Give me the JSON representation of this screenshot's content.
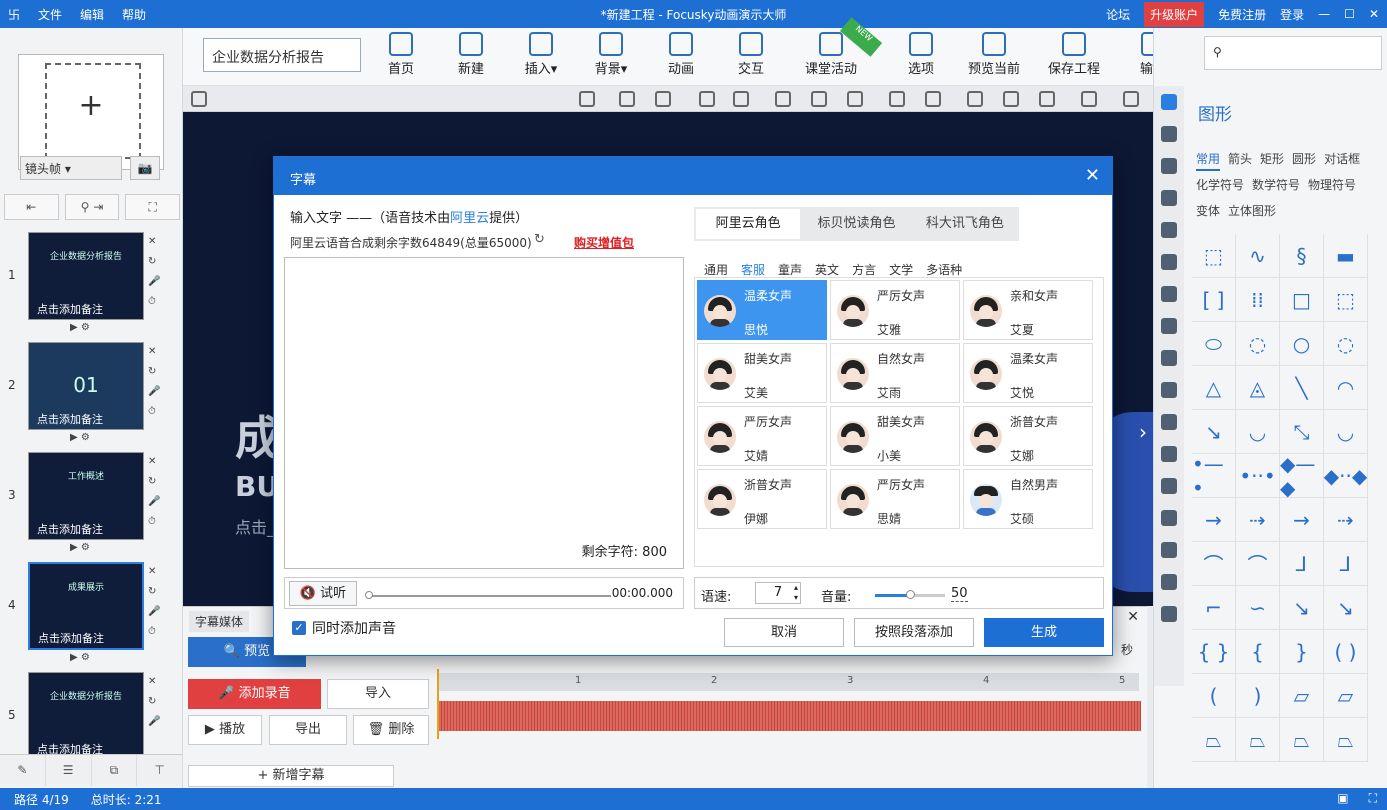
{
  "titlebar": {
    "menu": [
      "文件",
      "编辑",
      "帮助"
    ],
    "title": "*新建工程 - Focusky动画演示大师",
    "forum": "论坛",
    "upgrade": "升级账户",
    "register": "免费注册",
    "login": "登录"
  },
  "left": {
    "camera_select": "镜头帧",
    "slides": [
      {
        "num": "1",
        "caption": "企业数据分析报告",
        "note": "点击添加备注"
      },
      {
        "num": "2",
        "caption": "01",
        "note": "点击添加备注"
      },
      {
        "num": "3",
        "caption": "工作概述",
        "note": "点击添加备注"
      },
      {
        "num": "4",
        "caption": "成果展示",
        "note": "点击添加备注"
      },
      {
        "num": "5",
        "caption": "企业数据分析报告",
        "note": "点击添加备注"
      }
    ]
  },
  "status": {
    "path": "路径 4/19",
    "duration": "总时长: 2:21"
  },
  "toolbar": {
    "project_name": "企业数据分析报告",
    "buttons": [
      "首页",
      "新建",
      "插入",
      "背景",
      "动画",
      "交互",
      "课堂活动",
      "选项",
      "预览当前",
      "保存工程",
      "输出"
    ],
    "new_badge": "NEW"
  },
  "canvas": {
    "big": "成",
    "bu": "BU",
    "sub": "点击_"
  },
  "bottom": {
    "title": "字幕媒体",
    "preview": "预览",
    "add_record": "添加录音",
    "import": "导入",
    "play": "播放",
    "export": "导出",
    "delete": "删除",
    "add_subtitle": "+ 新增字幕",
    "sec": "秒",
    "ruler": [
      "1",
      "2",
      "3",
      "4",
      "5"
    ]
  },
  "right": {
    "title": "图形",
    "tabs": [
      "常用",
      "箭头",
      "矩形",
      "圆形",
      "对话框",
      "化学符号",
      "数学符号",
      "物理符号",
      "变体",
      "立体图形"
    ]
  },
  "dialog": {
    "title": "字幕",
    "input_label_prefix": "输入文字 ——（语音技术由",
    "input_label_link": "阿里云",
    "input_label_suffix": "提供）",
    "count_text": "阿里云语音合成剩余字数64849(总量65000)",
    "buy": "购买增值包",
    "remaining": "剩余字符: 800",
    "try": "试听",
    "time": "00:00.000",
    "add_audio": "同时添加声音",
    "tabs": [
      "阿里云角色",
      "标贝悦读角色",
      "科大讯飞角色"
    ],
    "categories": [
      "通用",
      "客服",
      "童声",
      "英文",
      "方言",
      "文学",
      "多语种"
    ],
    "voices": [
      {
        "style": "温柔女声",
        "name": "思悦"
      },
      {
        "style": "严厉女声",
        "name": "艾雅"
      },
      {
        "style": "亲和女声",
        "name": "艾夏"
      },
      {
        "style": "甜美女声",
        "name": "艾美"
      },
      {
        "style": "自然女声",
        "name": "艾雨"
      },
      {
        "style": "温柔女声",
        "name": "艾悦"
      },
      {
        "style": "严厉女声",
        "name": "艾婧"
      },
      {
        "style": "甜美女声",
        "name": "小美"
      },
      {
        "style": "浙普女声",
        "name": "艾娜"
      },
      {
        "style": "浙普女声",
        "name": "伊娜"
      },
      {
        "style": "严厉女声",
        "name": "思婧"
      },
      {
        "style": "自然男声",
        "name": "艾硕"
      }
    ],
    "speed_label": "语速:",
    "speed": "7",
    "volume_label": "音量:",
    "volume": "50",
    "volume_level": 0.5,
    "cancel": "取消",
    "by_paragraph": "按照段落添加",
    "generate": "生成"
  }
}
